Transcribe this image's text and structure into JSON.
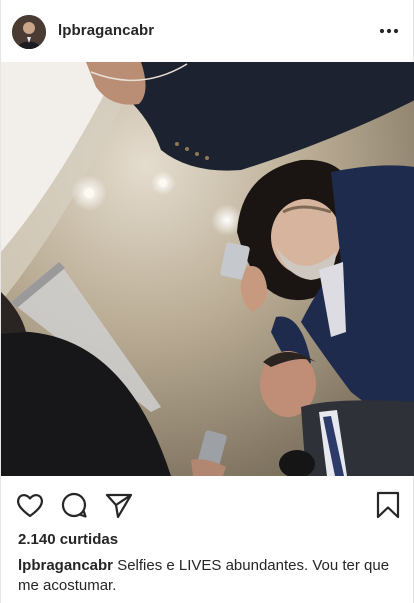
{
  "post": {
    "username": "lpbragancabr",
    "likes_text": "2.140 curtidas",
    "caption_user": "lpbragancabr",
    "caption_text": "Selfies e LIVES abundantes.  Vou ter que me acostumar."
  },
  "icons": {
    "more": "more-options-icon",
    "like": "heart-icon",
    "comment": "comment-icon",
    "share": "share-icon",
    "save": "bookmark-icon"
  },
  "colors": {
    "text": "#262626",
    "border": "#e6e6e6"
  }
}
